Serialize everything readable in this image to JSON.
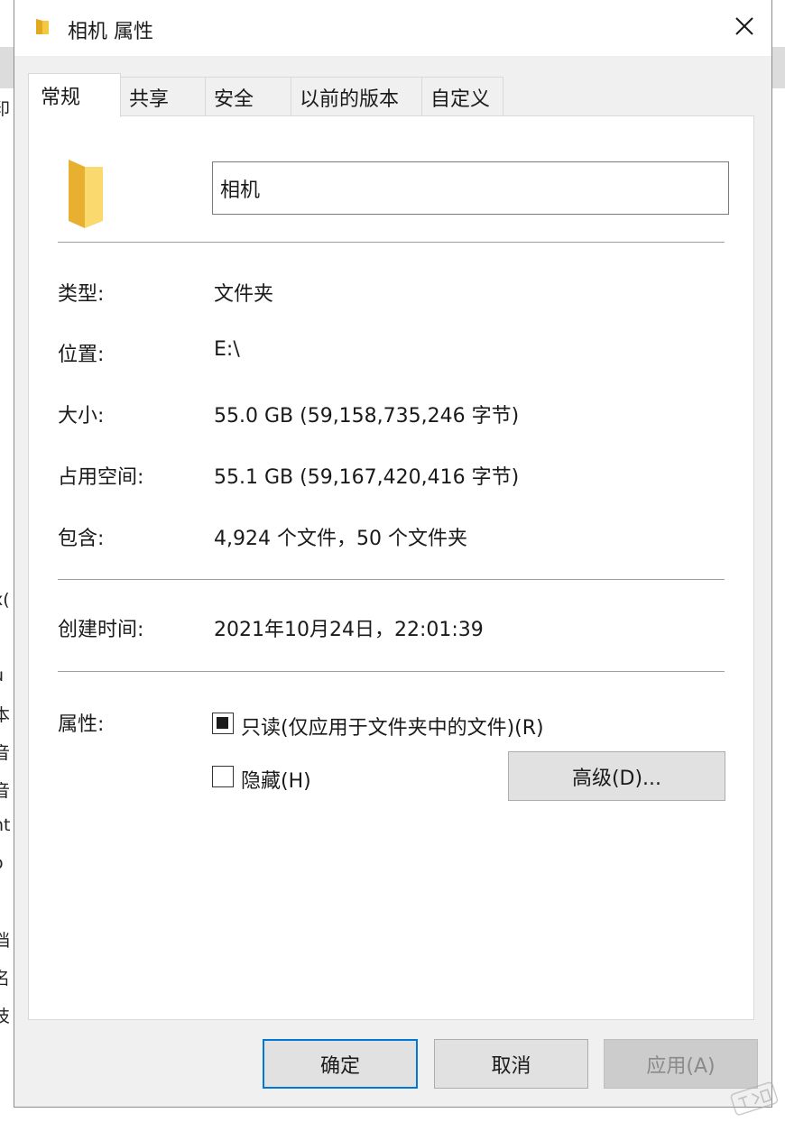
{
  "window": {
    "title": "相机 属性",
    "icons": {
      "title": "folder-icon",
      "close": "close-icon"
    }
  },
  "tabs": [
    {
      "label": "常规",
      "active": true
    },
    {
      "label": "共享",
      "active": false
    },
    {
      "label": "安全",
      "active": false
    },
    {
      "label": "以前的版本",
      "active": false
    },
    {
      "label": "自定义",
      "active": false
    }
  ],
  "general": {
    "folder_icon": "folder-icon",
    "name_value": "相机",
    "rows": {
      "type": {
        "label": "类型:",
        "value": "文件夹"
      },
      "location": {
        "label": "位置:",
        "value": "E:\\"
      },
      "size": {
        "label": "大小:",
        "value": "55.0 GB (59,158,735,246 字节)"
      },
      "size_on_disk": {
        "label": "占用空间:",
        "value": "55.1 GB (59,167,420,416 字节)"
      },
      "contains": {
        "label": "包含:",
        "value": "4,924 个文件，50 个文件夹"
      },
      "created": {
        "label": "创建时间:",
        "value": "2021年10月24日，22:01:39"
      }
    },
    "attributes": {
      "label": "属性:",
      "readonly": {
        "label": "只读(仅应用于文件夹中的文件)(R)",
        "state": "indeterminate"
      },
      "hidden": {
        "label": "隐藏(H)",
        "checked": false
      },
      "advanced_button": "高级(D)..."
    }
  },
  "footer": {
    "ok": "确定",
    "cancel": "取消",
    "apply": "应用(A)"
  },
  "background": {
    "fragments": [
      "印",
      "x(",
      "u",
      "本",
      "音",
      "音",
      "nt",
      "o",
      "档",
      "名",
      "技"
    ]
  },
  "colors": {
    "accent": "#0078d7",
    "folder": "#f5c842",
    "dialog_bg": "#f0f0f0",
    "panel_bg": "#ffffff"
  }
}
